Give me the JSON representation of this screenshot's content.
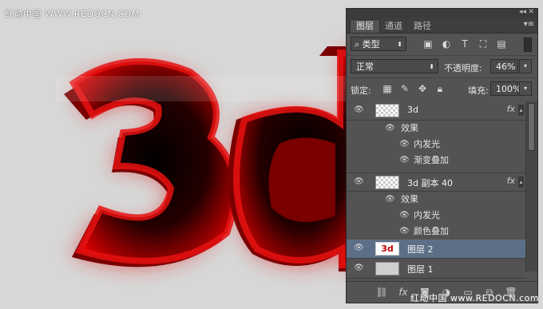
{
  "watermark": {
    "top": "红动中国 WWW.REDOCN.COM",
    "bottom": "红动中国 www.REDOCN.com"
  },
  "artwork": {
    "text": "3d",
    "color": "#d40000",
    "dark": "#1a0000"
  },
  "panel": {
    "tabs": [
      "图层",
      "通道",
      "路径"
    ],
    "filter": {
      "label": "类型"
    },
    "blend_mode": "正常",
    "opacity_label": "不透明度:",
    "opacity_value": "46%",
    "lock_label": "锁定:",
    "fill_label": "填充:",
    "fill_value": "100%",
    "layers": [
      {
        "name": "3d",
        "fx": "fx",
        "effects_label": "效果",
        "effects": [
          "内发光",
          "渐变叠加"
        ]
      },
      {
        "name": "3d 副本 40",
        "fx": "fx",
        "effects_label": "效果",
        "effects": [
          "内发光",
          "颜色叠加"
        ]
      },
      {
        "name": "图层 2",
        "thumb_text": "3d",
        "selected": true
      },
      {
        "name": "图层 1"
      }
    ]
  },
  "icons": [
    "eye-icon",
    "search-icon",
    "image-filter-icon",
    "adjust-filter-icon",
    "text-filter-icon",
    "shape-filter-icon",
    "smart-filter-icon",
    "lock-pixels-icon",
    "lock-brush-icon",
    "lock-move-icon",
    "lock-all-icon",
    "link-icon",
    "fx-icon",
    "mask-icon",
    "adjustment-icon",
    "folder-icon",
    "new-layer-icon",
    "trash-icon"
  ]
}
